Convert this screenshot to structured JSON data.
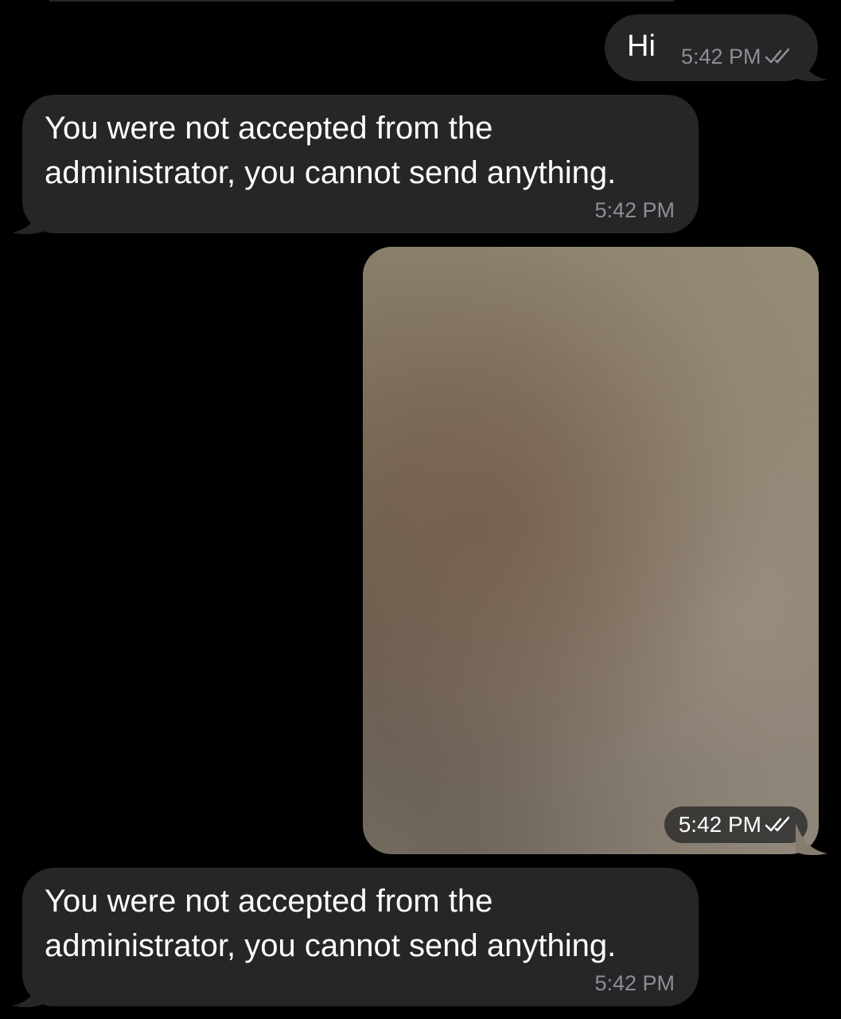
{
  "colors": {
    "background": "#000000",
    "bubble": "#262628",
    "text": "#ffffff",
    "meta": "#8e8e93"
  },
  "messages": [
    {
      "direction": "outgoing",
      "type": "text",
      "text": "Hi",
      "time": "5:42 PM",
      "status_icon": "double-check-icon"
    },
    {
      "direction": "incoming",
      "type": "text",
      "text": "You were not accepted from the administrator, you cannot send anything.",
      "time": "5:42 PM"
    },
    {
      "direction": "outgoing",
      "type": "photo",
      "time": "5:42 PM",
      "status_icon": "double-check-icon"
    },
    {
      "direction": "incoming",
      "type": "text",
      "text": "You were not accepted from the administrator, you cannot send anything.",
      "time": "5:42 PM"
    }
  ]
}
